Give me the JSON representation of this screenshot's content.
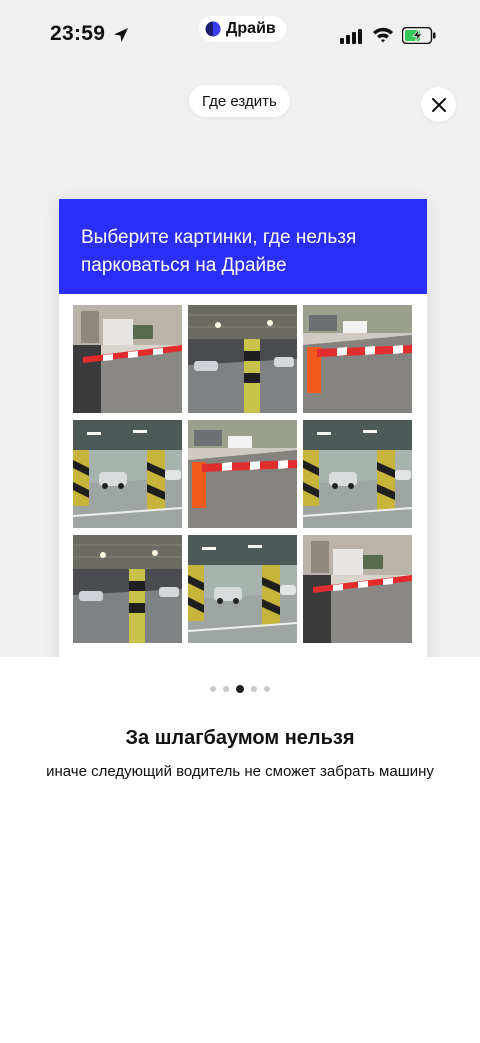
{
  "status_bar": {
    "time": "23:59",
    "app_name": "Драйв",
    "icons": [
      "location-arrow-icon",
      "cellular-signal-icon",
      "wifi-icon",
      "battery-charging-icon"
    ]
  },
  "top": {
    "where_button": "Где ездить",
    "close_icon": "close-icon"
  },
  "card": {
    "title": "Выберите картинки, где нельзя парковаться на Драйве",
    "header_color": "#2a2ef7",
    "tiles": [
      "street-barrier",
      "parking-pillar",
      "street-barrier-orange",
      "garage-cars",
      "street-barrier-orange",
      "garage-cars",
      "parking-pillar",
      "garage-cars",
      "street-barrier"
    ]
  },
  "pager": {
    "count": 5,
    "active_index": 2
  },
  "bottom": {
    "headline": "За шлагбаумом нельзя",
    "subtitle": "иначе следующий водитель не сможет забрать машину"
  }
}
